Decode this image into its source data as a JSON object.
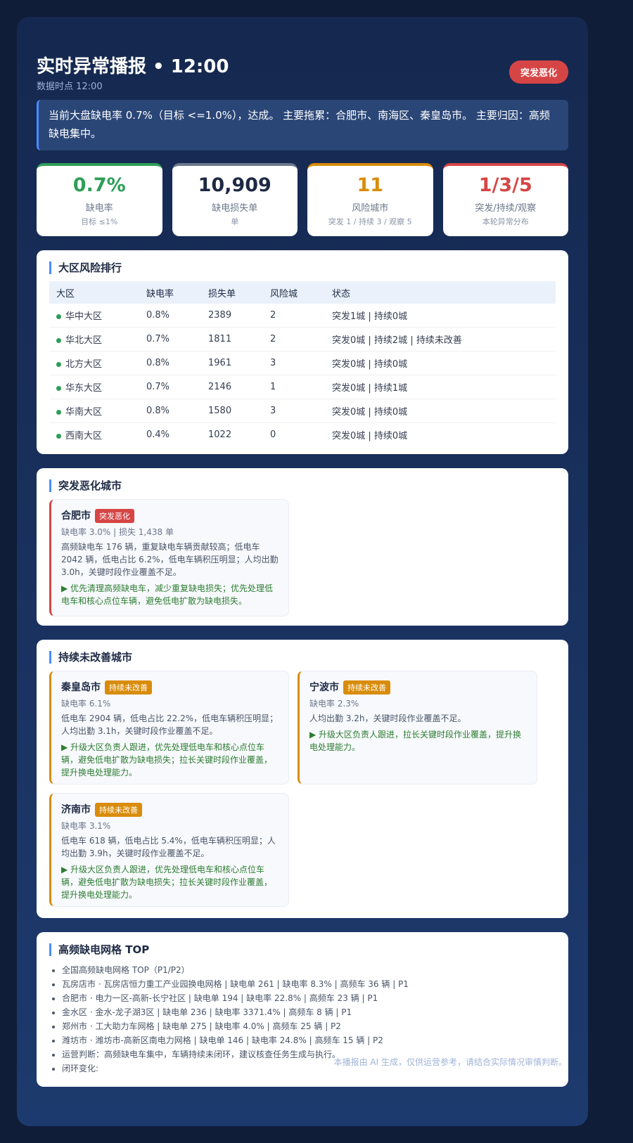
{
  "header": {
    "title": "实时异常播报 • 12:00",
    "subtitle": "数据时点 12:00",
    "badge": "突发恶化"
  },
  "summary": "当前大盘缺电率 0.7%（目标 <=1.0%），达成。 主要拖累：合肥市、南海区、秦皇岛市。 主要归因：高频缺电集中。",
  "kpis": [
    {
      "value": "0.7%",
      "label": "缺电率",
      "sub": "目标 ≤1%",
      "color": "#2e9e57"
    },
    {
      "value": "10,909",
      "label": "缺电损失单",
      "sub": "单",
      "color": "#1e2a44"
    },
    {
      "value": "11",
      "label": "风险城市",
      "sub": "突发 1 / 持续 3 / 观察 5",
      "color": "#d98c0a"
    },
    {
      "value": "1/3/5",
      "label": "突发/持续/观察",
      "sub": "本轮异常分布",
      "color": "#d64545"
    }
  ],
  "region_table": {
    "title": "大区风险排行",
    "headers": [
      "大区",
      "缺电率",
      "损失单",
      "风险城",
      "状态"
    ],
    "rows": [
      [
        "华中大区",
        "0.8%",
        "2389",
        "2",
        "突发1城 | 持续0城"
      ],
      [
        "华北大区",
        "0.7%",
        "1811",
        "2",
        "突发0城 | 持续2城 | 持续未改善"
      ],
      [
        "北方大区",
        "0.8%",
        "1961",
        "3",
        "突发0城 | 持续0城"
      ],
      [
        "华东大区",
        "0.7%",
        "2146",
        "1",
        "突发0城 | 持续1城"
      ],
      [
        "华南大区",
        "0.8%",
        "1580",
        "3",
        "突发0城 | 持续0城"
      ],
      [
        "西南大区",
        "0.4%",
        "1022",
        "0",
        "突发0城 | 持续0城"
      ]
    ]
  },
  "sudden": {
    "title": "突发恶化城市",
    "cities": [
      {
        "name": "合肥市",
        "tag": "突发恶化",
        "meta": "缺电率 3.0% | 损失 1,438 单",
        "desc": "高频缺电车 176 辆，重复缺电车辆贡献较高；低电车 2042 辆，低电占比 6.2%，低电车辆积压明显；人均出勤 3.0h，关键时段作业覆盖不足。",
        "action": "▶ 优先清理高频缺电车，减少重复缺电损失；优先处理低电车和核心点位车辆，避免低电扩散为缺电损失。"
      }
    ]
  },
  "persistent": {
    "title": "持续未改善城市",
    "cities": [
      {
        "name": "秦皇岛市",
        "tag": "持续未改善",
        "meta": "缺电率 6.1%",
        "desc": "低电车 2904 辆，低电占比 22.2%，低电车辆积压明显；人均出勤 3.1h，关键时段作业覆盖不足。",
        "action": "▶ 升级大区负责人跟进，优先处理低电车和核心点位车辆，避免低电扩散为缺电损失；拉长关键时段作业覆盖，提升换电处理能力。"
      },
      {
        "name": "宁波市",
        "tag": "持续未改善",
        "meta": "缺电率 2.3%",
        "desc": "人均出勤 3.2h，关键时段作业覆盖不足。",
        "action": "▶ 升级大区负责人跟进，拉长关键时段作业覆盖，提升换电处理能力。"
      },
      {
        "name": "济南市",
        "tag": "持续未改善",
        "meta": "缺电率 3.1%",
        "desc": "低电车 618 辆，低电占比 5.4%，低电车辆积压明显；人均出勤 3.9h，关键时段作业覆盖不足。",
        "action": "▶ 升级大区负责人跟进，优先处理低电车和核心点位车辆，避免低电扩散为缺电损失；拉长关键时段作业覆盖，提升换电处理能力。"
      }
    ]
  },
  "grids": {
    "title": "高频缺电网格 TOP",
    "items": [
      "全国高频缺电网格 TOP（P1/P2）",
      "瓦房店市 · 瓦房店恒力重工产业园换电网格 | 缺电单 261 | 缺电率 8.3% | 高频车 36 辆 | P1",
      "合肥市 · 电力一区-高新-长宁社区 | 缺电单 194 | 缺电率 22.8% | 高频车 23 辆 | P1",
      "金水区 · 金水-龙子湖3区 | 缺电单 236 | 缺电率 3371.4% | 高频车 8 辆 | P1",
      "郑州市 · 工大助力车网格 | 缺电单 275 | 缺电率 4.0% | 高频车 25 辆 | P2",
      "潍坊市 · 潍坊市-高新区南电力网格 | 缺电单 146 | 缺电率 24.8% | 高频车 15 辆 | P2",
      "运营判断：高频缺电车集中，车辆持续未闭环，建议核查任务生成与执行。",
      "闭环变化:"
    ]
  },
  "footer": "本播报由 AI 生成，仅供运营参考，请结合实际情况审慎判断。",
  "colors": {
    "sudden": "#d64545",
    "persistent": "#d98c0a",
    "accent": "#4a8cff",
    "ok": "#2e9e57"
  }
}
